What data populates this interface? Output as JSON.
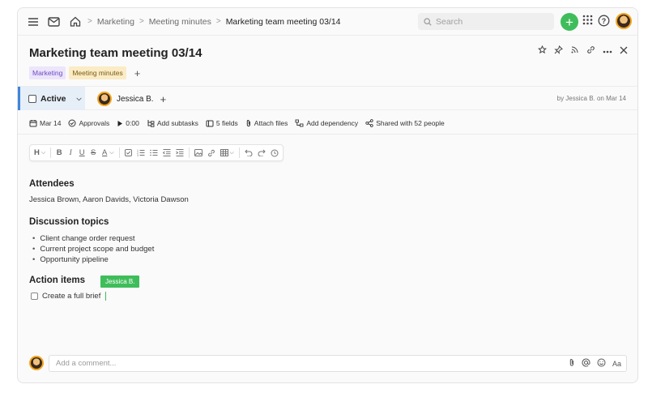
{
  "breadcrumb": {
    "items": [
      "Marketing",
      "Meeting minutes",
      "Marketing team meeting 03/14"
    ]
  },
  "search": {
    "placeholder": "Search"
  },
  "task": {
    "title": "Marketing team meeting 03/14",
    "tags": [
      "Marketing",
      "Meeting minutes"
    ],
    "status": "Active",
    "assignee": "Jessica B.",
    "byline": "by Jessica B. on Mar 14"
  },
  "meta": {
    "date": "Mar 14",
    "approvals": "Approvals",
    "timer": "0:00",
    "subtasks": "Add subtasks",
    "fields": "5 fields",
    "attach": "Attach files",
    "dependency": "Add dependency",
    "shared": "Shared with 52 people"
  },
  "editor": {
    "heading_btn": "H",
    "attendees_heading": "Attendees",
    "attendees_text": "Jessica Brown, Aaron Davids, Victoria Dawson",
    "discussion_heading": "Discussion topics",
    "topics": [
      "Client change order request",
      "Current project scope and budget",
      "Opportunity pipeline"
    ],
    "action_heading": "Action items",
    "action_item": "Create a full brief",
    "cursor_user": "Jessica B."
  },
  "comment": {
    "placeholder": "Add a comment...",
    "format_label": "Aa"
  },
  "colors": {
    "accent_green": "#3fbd5a",
    "status_blue": "#3f86d9",
    "tag_purple_bg": "#ece5fb",
    "tag_yellow_bg": "#fbecc6"
  }
}
